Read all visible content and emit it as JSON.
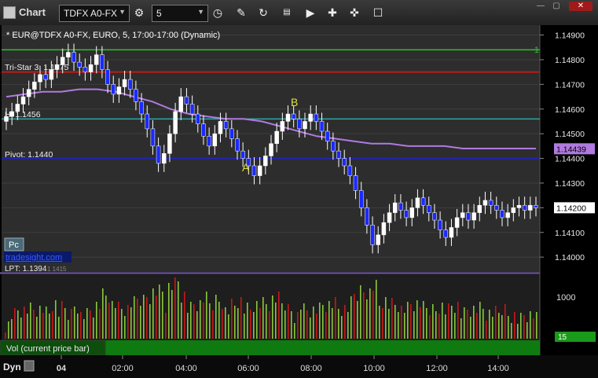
{
  "window": {
    "title": "Chart",
    "symbol": "TDFX A0-FX",
    "interval": "5",
    "icons": [
      "settings-icon",
      "clock-icon",
      "pencil-icon",
      "refresh-icon",
      "data-icon",
      "play-icon",
      "tag-icon",
      "chat-icon"
    ]
  },
  "chart_header": {
    "text": "* EUR@TDFX A0-FX, EURO, 5, 17:00-17:00 (Dynamic)"
  },
  "levels": [
    {
      "label": "Tri-Star 3: 1.1475",
      "value": 1.1475,
      "color": "#c01818"
    },
    {
      "label": "H: 1.1456",
      "value": 1.1456,
      "color": "#2aa8a8"
    },
    {
      "label": "Pivot: 1.1440",
      "value": 1.144,
      "color": "#2222c8"
    }
  ],
  "green_level": {
    "value": 1.1484,
    "marker": "1"
  },
  "lpt_label": "LPT: 1.1394",
  "lpt_sub": "1 1415",
  "annotations": {
    "a": "A",
    "b": "B"
  },
  "watermark": "tradesight.com",
  "pc_button": "Pc",
  "price_axis": {
    "ticks": [
      "1.14900",
      "1.14800",
      "1.14700",
      "1.14600",
      "1.14500",
      "1.14400",
      "1.14300",
      "1.14200",
      "1.14100",
      "1.14000"
    ],
    "current_price": "1.14200",
    "ma_price": "1.14439"
  },
  "volume": {
    "label": "Vol (current price bar)",
    "tick": "1000",
    "current": "15"
  },
  "time_axis": {
    "mode": "Dyn",
    "labels": [
      "04",
      "02:00",
      "04:00",
      "06:00",
      "08:00",
      "10:00",
      "12:00",
      "14:00"
    ]
  },
  "chart_data": {
    "type": "candlestick",
    "ylim": [
      1.1394,
      1.1494
    ],
    "series_ma_color": "#b07ae0",
    "closes": [
      1.1457,
      1.1459,
      1.1462,
      1.1465,
      1.1468,
      1.1471,
      1.1474,
      1.1472,
      1.1476,
      1.1478,
      1.1481,
      1.1483,
      1.1479,
      1.1477,
      1.1475,
      1.1478,
      1.1482,
      1.1476,
      1.147,
      1.1466,
      1.1469,
      1.1472,
      1.1468,
      1.1463,
      1.1458,
      1.1452,
      1.1445,
      1.1438,
      1.1442,
      1.145,
      1.1459,
      1.1465,
      1.1462,
      1.1458,
      1.1454,
      1.1449,
      1.1445,
      1.145,
      1.1455,
      1.1452,
      1.1448,
      1.1443,
      1.144,
      1.1437,
      1.1433,
      1.1437,
      1.1441,
      1.1446,
      1.1451,
      1.1455,
      1.1458,
      1.1456,
      1.1452,
      1.1455,
      1.1458,
      1.1455,
      1.1451,
      1.1447,
      1.1443,
      1.144,
      1.1437,
      1.1433,
      1.1427,
      1.142,
      1.1413,
      1.1405,
      1.1409,
      1.1414,
      1.1418,
      1.1422,
      1.1419,
      1.1416,
      1.142,
      1.1424,
      1.1421,
      1.1418,
      1.1415,
      1.1411,
      1.1408,
      1.1412,
      1.1416,
      1.1418,
      1.1415,
      1.1418,
      1.1421,
      1.1423,
      1.1421,
      1.1419,
      1.1416,
      1.1418,
      1.142,
      1.1421,
      1.1419,
      1.1421,
      1.142
    ],
    "ma": [
      1.1465,
      1.1466,
      1.1467,
      1.1467,
      1.1468,
      1.1468,
      1.1467,
      1.1465,
      1.1463,
      1.146,
      1.1458,
      1.1457,
      1.1456,
      1.1456,
      1.1455,
      1.1453,
      1.1451,
      1.1449,
      1.1448,
      1.1447,
      1.1446,
      1.1446,
      1.1445,
      1.1445,
      1.1445,
      1.1444,
      1.1444,
      1.1444,
      1.1444,
      1.1444
    ]
  }
}
